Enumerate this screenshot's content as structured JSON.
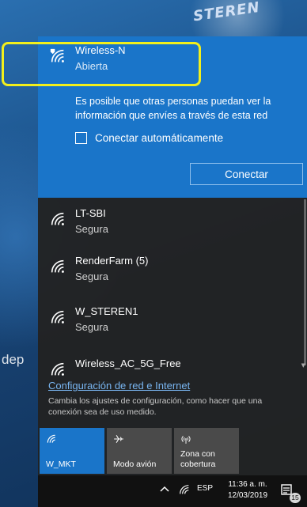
{
  "wallpaper": {
    "logo_text": "STEREN",
    "partial_text": "dep"
  },
  "selected_network": {
    "name": "Wireless-N",
    "status": "Abierta",
    "info_text": "Es posible que otras personas puedan ver la información que envíes a través de esta red",
    "auto_connect_label": "Conectar automáticamente",
    "auto_connect_checked": false,
    "connect_button_label": "Conectar",
    "icon": "wifi-secure-warning-icon"
  },
  "networks": [
    {
      "name": "LT-SBI",
      "status": "Segura",
      "icon": "wifi-icon"
    },
    {
      "name": "RenderFarm (5)",
      "status": "Segura",
      "icon": "wifi-icon"
    },
    {
      "name": "W_STEREN1",
      "status": "Segura",
      "icon": "wifi-icon"
    },
    {
      "name": "Wireless_AC_5G_Free",
      "status": "",
      "icon": "wifi-icon"
    }
  ],
  "settings": {
    "link_label": "Configuración de red e Internet",
    "description": "Cambia los ajustes de configuración, como hacer que una conexión sea de uso medido."
  },
  "quick_actions": [
    {
      "label": "W_MKT",
      "icon": "wifi-icon",
      "active": true
    },
    {
      "label": "Modo avión",
      "icon": "airplane-icon",
      "active": false
    },
    {
      "label": "Zona con cobertura",
      "icon": "hotspot-icon",
      "active": false
    }
  ],
  "taskbar": {
    "language": "ESP",
    "time": "11:36 a. m.",
    "date": "12/03/2019",
    "notification_count": "15"
  },
  "colors": {
    "accent": "#1a75c9",
    "highlight": "#f2ef1c",
    "link": "#79b6f2",
    "flyout_bg": "#222222"
  }
}
